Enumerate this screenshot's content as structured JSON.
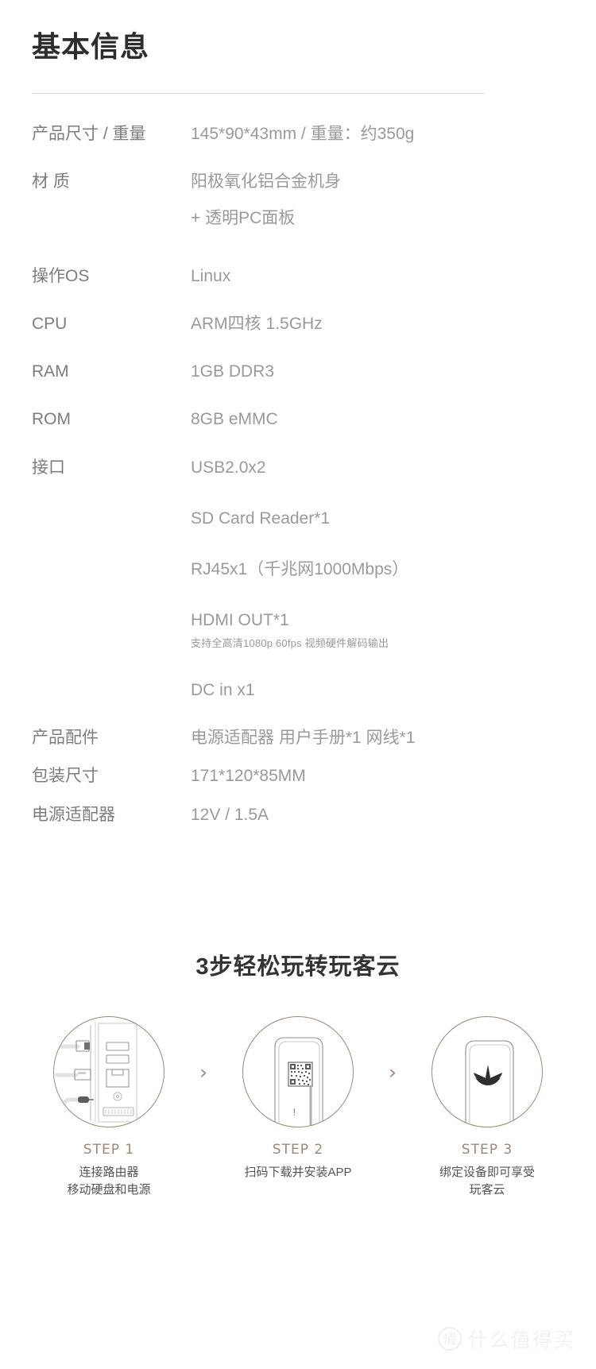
{
  "spec_section": {
    "title": "基本信息",
    "rows": [
      {
        "label": "产品尺寸 / 重量",
        "value": "145*90*43mm / 重量：约350g"
      },
      {
        "label": "材 质",
        "value": "阳极氧化铝合金机身",
        "value2": "+ 透明PC面板"
      },
      {
        "label": "操作OS",
        "value": "Linux"
      },
      {
        "label": "CPU",
        "value": "ARM四核 1.5GHz"
      },
      {
        "label": "RAM",
        "value": "1GB DDR3"
      },
      {
        "label": "ROM",
        "value": "8GB eMMC"
      },
      {
        "label": "接口",
        "value": "USB2.0x2",
        "value2": "SD Card Reader*1",
        "value3": "RJ45x1（千兆网1000Mbps）",
        "value4": "HDMI OUT*1",
        "fineprint": "支持全高清1080p 60fps 视频硬件解码输出",
        "value5": "DC in x1"
      },
      {
        "label": "产品配件",
        "value": "电源适配器  用户手册*1    网线*1"
      },
      {
        "label": "包装尺寸",
        "value": "171*120*85MM"
      },
      {
        "label": "电源适配器",
        "value": "12V / 1.5A"
      }
    ]
  },
  "steps_section": {
    "title": "3步轻松玩转玩客云",
    "arrow": "›",
    "steps": [
      {
        "name": "STEP 1",
        "desc_line1": "连接路由器",
        "desc_line2": "移动硬盘和电源",
        "icon": "device-ports-icon"
      },
      {
        "name": "STEP 2",
        "desc_line1": "扫码下载并安装APP",
        "desc_line2": "",
        "icon": "qr-code-phone-icon"
      },
      {
        "name": "STEP 3",
        "desc_line1": "绑定设备即可享受",
        "desc_line2": "玩客云",
        "icon": "lotus-logo-icon"
      }
    ]
  },
  "watermark": {
    "logo_char": "值",
    "text": "什么值得买"
  },
  "colors": {
    "heading": "#2d2d2d",
    "label": "#7d7d7d",
    "value": "#9a9a9a",
    "accent_brown": "#9d8878",
    "divider": "#dcdcdc"
  }
}
